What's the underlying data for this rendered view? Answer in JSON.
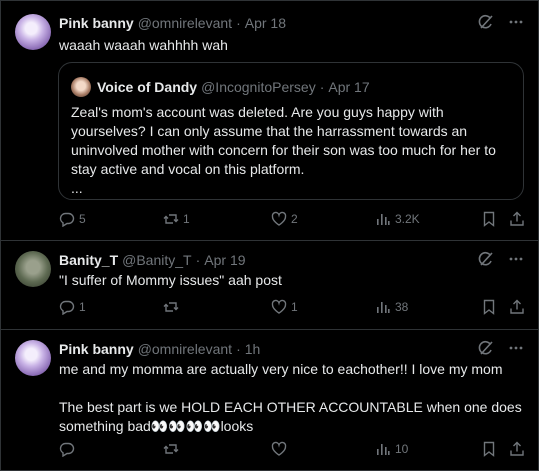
{
  "posts": [
    {
      "name": "Pink banny",
      "handle": "@omnirelevant",
      "time": "Apr 18",
      "text": "waaah waaah wahhhh wah",
      "quote": {
        "name": "Voice of Dandy",
        "handle": "@IncognitoPersey",
        "time": "Apr 17",
        "text": "Zeal's mom's account was deleted. Are you guys happy with yourselves? I can only assume that the harrassment towards an uninvolved mother with concern for their son was too much for her to stay active and vocal on this platform.\n..."
      },
      "replies": "5",
      "reposts": "1",
      "likes": "2",
      "views": "3.2K"
    },
    {
      "name": "Banity_T",
      "handle": "@Banity_T",
      "time": "Apr 19",
      "text": "\"I suffer of Mommy issues\" aah post",
      "replies": "1",
      "reposts": "",
      "likes": "1",
      "views": "38"
    },
    {
      "name": "Pink banny",
      "handle": "@omnirelevant",
      "time": "1h",
      "text": "me and my momma are actually very nice to eachother!! I love my mom\n\nThe best part is we HOLD EACH OTHER ACCOUNTABLE when one does something bad👀👀👀👀looks",
      "replies": "",
      "reposts": "",
      "likes": "",
      "views": "10"
    }
  ],
  "colors": {
    "background": "#000000",
    "text": "#e7e9ea",
    "muted": "#71767b",
    "border": "#2f3336"
  },
  "icons": [
    "grok-icon",
    "more-icon",
    "reply-icon",
    "repost-icon",
    "like-icon",
    "views-icon",
    "bookmark-icon",
    "share-icon"
  ]
}
